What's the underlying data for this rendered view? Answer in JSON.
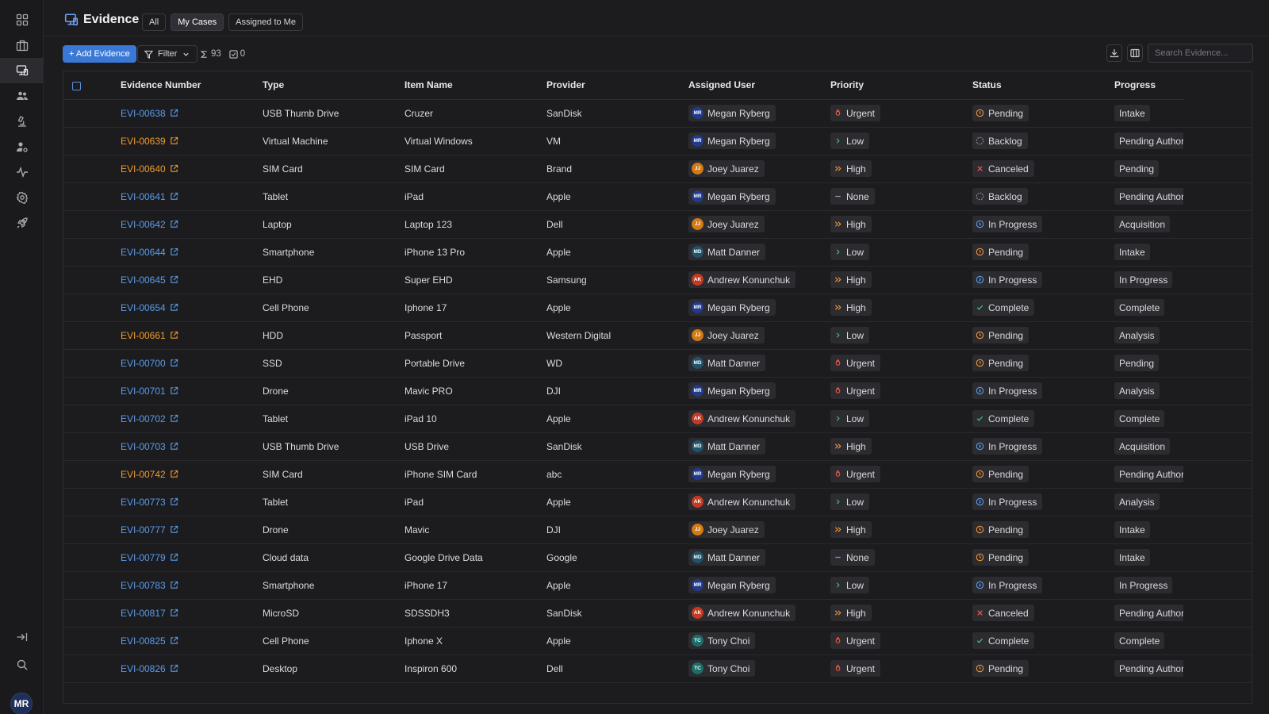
{
  "app": {
    "title": "Evidence",
    "tabs": [
      {
        "label": "All",
        "active": false
      },
      {
        "label": "My Cases",
        "active": true
      },
      {
        "label": "Assigned to Me",
        "active": false
      }
    ]
  },
  "sidebar": {
    "items": [
      {
        "name": "dashboard",
        "icon": "grid-icon",
        "active": false
      },
      {
        "name": "cases",
        "icon": "briefcase-icon",
        "active": false
      },
      {
        "name": "evidence",
        "icon": "devices-icon",
        "active": true
      },
      {
        "name": "people",
        "icon": "users-icon",
        "active": false
      },
      {
        "name": "lab",
        "icon": "microscope-icon",
        "active": false
      },
      {
        "name": "user-settings",
        "icon": "user-gear-icon",
        "active": false
      },
      {
        "name": "activity",
        "icon": "activity-icon",
        "active": false
      },
      {
        "name": "settings",
        "icon": "gear-icon",
        "active": false
      },
      {
        "name": "launch",
        "icon": "rocket-icon",
        "active": false
      }
    ],
    "user_initials": "MR"
  },
  "toolbar": {
    "add_label": "+ Add Evidence",
    "filter_label": "Filter",
    "total_count": "93",
    "selected_count": "0",
    "search_placeholder": "Search Evidence..."
  },
  "colors": {
    "accent": "#3a78d6",
    "link_blue": "#5b9be8",
    "link_orange": "#f09a2b",
    "urgent": "#ee5a3d",
    "high": "#f0943a",
    "pending": "#f0943a",
    "in_progress": "#5b9be8",
    "complete": "#37c26b",
    "canceled": "#ee4d4d"
  },
  "table": {
    "columns": [
      "Evidence Number",
      "Type",
      "Item Name",
      "Provider",
      "Assigned User",
      "Priority",
      "Status",
      "Progress"
    ],
    "rows": [
      {
        "id": "EVI-00638",
        "flag": "blue",
        "type": "USB Thumb Drive",
        "item": "Cruzer",
        "provider": "SanDisk",
        "user": "Megan Ryberg",
        "initials": "MR",
        "priority": "Urgent",
        "status": "Pending",
        "progress": "Intake"
      },
      {
        "id": "EVI-00639",
        "flag": "orange",
        "type": "Virtual Machine",
        "item": "Virtual Windows",
        "provider": "VM",
        "user": "Megan Ryberg",
        "initials": "MR",
        "priority": "Low",
        "status": "Backlog",
        "progress": "Pending Authority"
      },
      {
        "id": "EVI-00640",
        "flag": "orange",
        "type": "SIM Card",
        "item": "SIM Card",
        "provider": "Brand",
        "user": "Joey Juarez",
        "initials": "JJ",
        "priority": "High",
        "status": "Canceled",
        "progress": "Pending"
      },
      {
        "id": "EVI-00641",
        "flag": "blue",
        "type": "Tablet",
        "item": "iPad",
        "provider": "Apple",
        "user": "Megan Ryberg",
        "initials": "MR",
        "priority": "None",
        "status": "Backlog",
        "progress": "Pending Authority"
      },
      {
        "id": "EVI-00642",
        "flag": "blue",
        "type": "Laptop",
        "item": "Laptop 123",
        "provider": "Dell",
        "user": "Joey Juarez",
        "initials": "JJ",
        "priority": "High",
        "status": "In Progress",
        "progress": "Acquisition"
      },
      {
        "id": "EVI-00644",
        "flag": "blue",
        "type": "Smartphone",
        "item": "iPhone 13 Pro",
        "provider": "Apple",
        "user": "Matt Danner",
        "initials": "MD",
        "priority": "Low",
        "status": "Pending",
        "progress": "Intake"
      },
      {
        "id": "EVI-00645",
        "flag": "blue",
        "type": "EHD",
        "item": "Super EHD",
        "provider": "Samsung",
        "user": "Andrew Konunchuk",
        "initials": "AK",
        "priority": "High",
        "status": "In Progress",
        "progress": "In Progress"
      },
      {
        "id": "EVI-00654",
        "flag": "blue",
        "type": "Cell Phone",
        "item": "Iphone 17",
        "provider": "Apple",
        "user": "Megan Ryberg",
        "initials": "MR",
        "priority": "High",
        "status": "Complete",
        "progress": "Complete"
      },
      {
        "id": "EVI-00661",
        "flag": "orange",
        "type": "HDD",
        "item": "Passport",
        "provider": "Western Digital",
        "user": "Joey Juarez",
        "initials": "JJ",
        "priority": "Low",
        "status": "Pending",
        "progress": "Analysis"
      },
      {
        "id": "EVI-00700",
        "flag": "blue",
        "type": "SSD",
        "item": "Portable Drive",
        "provider": "WD",
        "user": "Matt Danner",
        "initials": "MD",
        "priority": "Urgent",
        "status": "Pending",
        "progress": "Pending"
      },
      {
        "id": "EVI-00701",
        "flag": "blue",
        "type": "Drone",
        "item": "Mavic PRO",
        "provider": "DJI",
        "user": "Megan Ryberg",
        "initials": "MR",
        "priority": "Urgent",
        "status": "In Progress",
        "progress": "Analysis"
      },
      {
        "id": "EVI-00702",
        "flag": "blue",
        "type": "Tablet",
        "item": "iPad 10",
        "provider": "Apple",
        "user": "Andrew Konunchuk",
        "initials": "AK",
        "priority": "Low",
        "status": "Complete",
        "progress": "Complete"
      },
      {
        "id": "EVI-00703",
        "flag": "blue",
        "type": "USB Thumb Drive",
        "item": "USB Drive",
        "provider": "SanDisk",
        "user": "Matt Danner",
        "initials": "MD",
        "priority": "High",
        "status": "In Progress",
        "progress": "Acquisition"
      },
      {
        "id": "EVI-00742",
        "flag": "orange",
        "type": "SIM Card",
        "item": "iPhone SIM Card",
        "provider": "abc",
        "user": "Megan Ryberg",
        "initials": "MR",
        "priority": "Urgent",
        "status": "Pending",
        "progress": "Pending Authority"
      },
      {
        "id": "EVI-00773",
        "flag": "blue",
        "type": "Tablet",
        "item": "iPad",
        "provider": "Apple",
        "user": "Andrew Konunchuk",
        "initials": "AK",
        "priority": "Low",
        "status": "In Progress",
        "progress": "Analysis"
      },
      {
        "id": "EVI-00777",
        "flag": "blue",
        "type": "Drone",
        "item": "Mavic",
        "provider": "DJI",
        "user": "Joey Juarez",
        "initials": "JJ",
        "priority": "High",
        "status": "Pending",
        "progress": "Intake"
      },
      {
        "id": "EVI-00779",
        "flag": "blue",
        "type": "Cloud data",
        "item": "Google Drive Data",
        "provider": "Google",
        "user": "Matt Danner",
        "initials": "MD",
        "priority": "None",
        "status": "Pending",
        "progress": "Intake"
      },
      {
        "id": "EVI-00783",
        "flag": "blue",
        "type": "Smartphone",
        "item": "iPhone 17",
        "provider": "Apple",
        "user": "Megan Ryberg",
        "initials": "MR",
        "priority": "Low",
        "status": "In Progress",
        "progress": "In Progress"
      },
      {
        "id": "EVI-00817",
        "flag": "blue",
        "type": "MicroSD",
        "item": "SDSSDH3",
        "provider": "SanDisk",
        "user": "Andrew Konunchuk",
        "initials": "AK",
        "priority": "High",
        "status": "Canceled",
        "progress": "Pending Authority"
      },
      {
        "id": "EVI-00825",
        "flag": "blue",
        "type": "Cell Phone",
        "item": "Iphone X",
        "provider": "Apple",
        "user": "Tony Choi",
        "initials": "TC",
        "priority": "Urgent",
        "status": "Complete",
        "progress": "Complete"
      },
      {
        "id": "EVI-00826",
        "flag": "blue",
        "type": "Desktop",
        "item": "Inspiron 600",
        "provider": "Dell",
        "user": "Tony Choi",
        "initials": "TC",
        "priority": "Urgent",
        "status": "Pending",
        "progress": "Pending Authority"
      }
    ]
  }
}
